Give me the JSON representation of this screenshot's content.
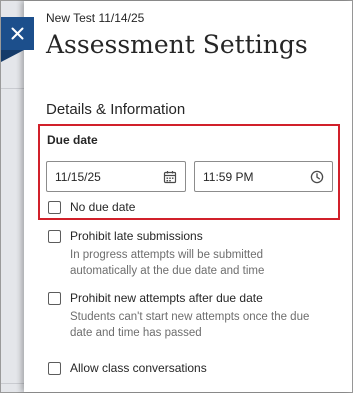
{
  "header": {
    "subtitle": "New Test 11/14/25",
    "title": "Assessment Settings"
  },
  "section": {
    "title": "Details & Information"
  },
  "due_date": {
    "label": "Due date",
    "date_value": "11/15/25",
    "time_value": "11:59 PM",
    "no_due_date_label": "No due date"
  },
  "options": {
    "prohibit_late": {
      "label": "Prohibit late submissions",
      "helper_line1": "In progress attempts will be submitted",
      "helper_line2": "automatically at the due date and time"
    },
    "prohibit_new_attempts": {
      "label": "Prohibit new attempts after due date",
      "helper_line1": "Students can't start new attempts once the due",
      "helper_line2": "date and time has passed"
    },
    "allow_conversations": {
      "label": "Allow class conversations"
    }
  },
  "colors": {
    "accent": "#1c4f8c",
    "highlight_border": "#d1202a",
    "helper_text": "#6e6e6e"
  },
  "icons": {
    "close": "close-icon",
    "date": "calendar-icon",
    "time": "clock-icon"
  }
}
